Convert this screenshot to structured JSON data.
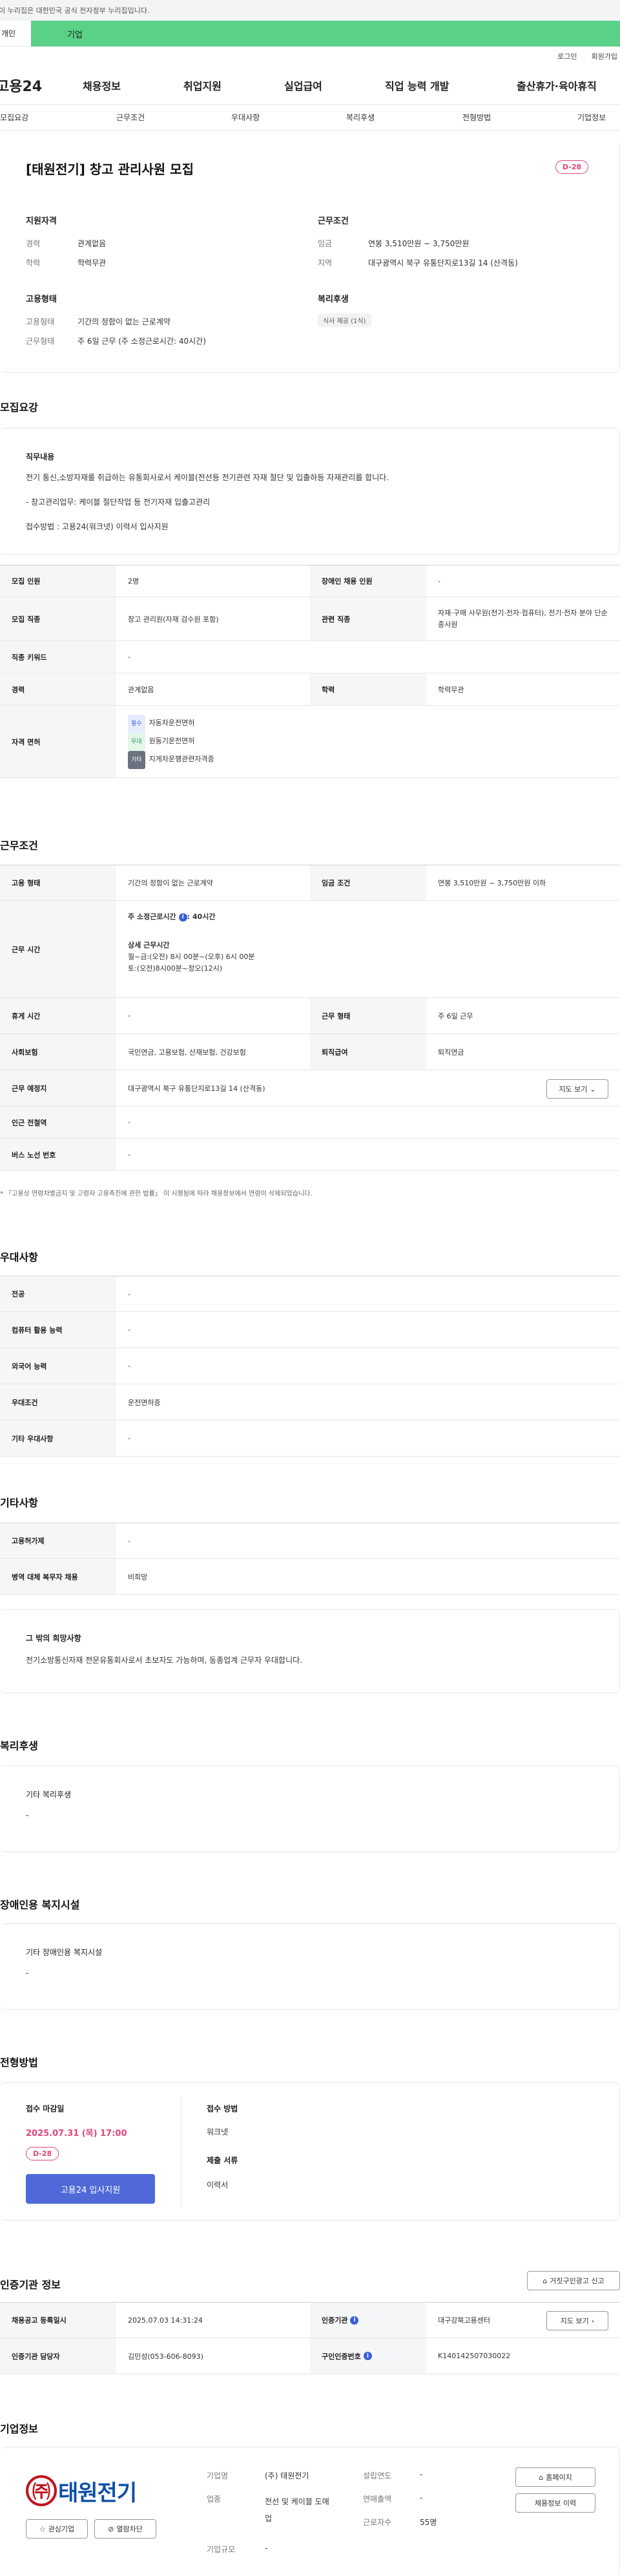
{
  "gov_notice": "이 누리집은 대한민국 공식 전자정부 누리집입니다.",
  "cat_tabs": {
    "left": "개인",
    "right": "기업"
  },
  "util": {
    "login": "로그인",
    "signup": "회원가입"
  },
  "gnb": {
    "logo": "고용24",
    "menu": [
      "채용정보",
      "취업지원",
      "실업급여",
      "직업 능력 개발",
      "출산휴가·육아휴직"
    ]
  },
  "subtabs": [
    "모집요강",
    "근무조건",
    "우대사항",
    "복리후생",
    "전형방법",
    "기업정보"
  ],
  "summary": {
    "title": "[태원전기] 창고 관리사원 모집",
    "dday": "D-28",
    "qual_title": "지원자격",
    "career_k": "경력",
    "career_v": "관계없음",
    "edu_k": "학력",
    "edu_v": "학력무관",
    "cond_title": "근무조건",
    "wage_k": "임금",
    "wage_v": "연봉 3,510만원 ~ 3,750만원",
    "region_k": "지역",
    "region_v": "대구광역시 북구 유통단지로13길 14 (산격동)",
    "emp_title": "고용형태",
    "emptype_k": "고용형태",
    "emptype_v": "기간의 정함이 없는 근로계약",
    "worktype_k": "근무형태",
    "worktype_v": "주 6일 근무 (주 소정근로시간: 40시간)",
    "welfare_title": "복리후생",
    "welfare_chip": "식사 제공 (1식)"
  },
  "recruit": {
    "heading": "모집요강",
    "duty_title": "직무내용",
    "duty_text": "전기 통신,소방자재를 취급하는 유통회사로서 케이블(전선등 전기관련 자재 절단 및 입출하등 자재관리를 합니다.",
    "duty_text2": "- 창고관리업무: 케이블 절단작업 등 전기자재 입출고관리",
    "duty_text3": "접수방법 : 고용24(워크넷) 이력서 입사지원",
    "rows": {
      "headcount_k": "모집 인원",
      "headcount_v": "2명",
      "disabled_k": "장애인 채용 인원",
      "disabled_v": "-",
      "job_k": "모집 직종",
      "job_v": "창고 관리원(자재 검수원 포함)",
      "related_k": "관련 직종",
      "related_v": "자재·구매 사무원(전기·전자·컴퓨터), 전기·전자 분야 단순 종사원",
      "keyword_k": "직종 키워드",
      "keyword_v": "-",
      "career_k": "경력",
      "career_v": "관계없음",
      "edu_k": "학력",
      "edu_v": "학력무관",
      "license_k": "자격 면허",
      "licenses": [
        {
          "badge": "필수",
          "name": "자동차운전면허"
        },
        {
          "badge": "우대",
          "name": "원동기운전면허"
        },
        {
          "badge": "기타",
          "name": "지게차운행관련자격증"
        }
      ]
    }
  },
  "work": {
    "heading": "근무조건",
    "emptype_k": "고용 형태",
    "emptype_v": "기간의 정함이 없는 근로계약",
    "wage_k": "임금 조건",
    "wage_v": "연봉 3,510만원 ~ 3,750만원 이하",
    "hours_k": "근무 시간",
    "hours_1": "주 소정근로시간",
    "hours_1v": ": 40시간",
    "hours_2": "상세 근무시간",
    "hours_3": "월~금:(오전) 8시 00분~(오후) 6시 00분",
    "hours_4": "토:(오전)8시00분~정오(12시)",
    "holiday_k": "휴게 시간",
    "holiday_v": "-",
    "worktype_k": "근무 형태",
    "worktype_v": "주 6일 근무",
    "insurance_k": "사회보험",
    "insurance_v": "국민연금, 고용보험, 산재보험, 건강보험",
    "retire_k": "퇴직급여",
    "retire_v": "퇴직연금",
    "place_k": "근무 예정지",
    "place_v": "대구광역시 북구 유통단지로13길 14 (산격동)",
    "map_btn": "지도 보기",
    "subway_k": "인근 전철역",
    "subway_v": "-",
    "bus_k": "버스 노선 번호",
    "bus_v": "-",
    "note": "* 「고용상 연령차별금지 및 고령자 고용촉진에 관한 법률」 이 시행됨에 따라 채용정보에서 연령이 삭제되었습니다."
  },
  "prefer": {
    "heading": "우대사항",
    "major_k": "전공",
    "major_v": "-",
    "computer_k": "컴퓨터 활용 능력",
    "computer_v": "-",
    "lang_k": "외국어 능력",
    "lang_v": "-",
    "cond_k": "우대조건",
    "cond_v": "운전면허증",
    "etc_k": "기타 우대사항",
    "etc_v": "-"
  },
  "other": {
    "heading": "기타사항",
    "type_k": "고용허가제",
    "type_v": "-",
    "military_k": "병역 대체 복무자 채용",
    "military_v": "비희망",
    "wish_title": "그 밖의 희망사항",
    "wish_text": "전기소방통신자재 전문유통회사로서 초보자도 가능하며, 동종업계 근무자 우대합니다."
  },
  "welfare": {
    "heading": "복리후생",
    "etc_title": "기타 복리후생",
    "etc_v": "-"
  },
  "facility": {
    "heading": "장애인용 복지시설",
    "title": "기타 장애인용 복지시설",
    "v": "-"
  },
  "process": {
    "heading": "전형방법",
    "deadline_title": "접수 마감일",
    "deadline": "2025.07.31 (목) 17:00",
    "dday": "D-28",
    "apply_btn": "고용24 입사지원",
    "method_title": "접수 방법",
    "method_v": "워크넷",
    "docs_title": "제출 서류",
    "docs_v": "이력서"
  },
  "agency": {
    "heading": "인증기관 정보",
    "report_btn": "거짓구인광고 신고",
    "reg_k": "채용공고 등록일시",
    "reg_v": "2025.07.03 14:31:24",
    "org_k": "인증기관",
    "org_v": "대구강북고용센터",
    "map_btn": "지도 보기",
    "mgr_k": "인증기관 담당자",
    "mgr_v": "김민성(053-606-8093)",
    "no_k": "구인인증번호",
    "no_v": "K140142507030022"
  },
  "company": {
    "heading": "기업정보",
    "logo_mark": "㈜",
    "logo_text": "태원전기",
    "fav_btn": "관심기업",
    "block_btn": "열람차단",
    "name_k": "기업명",
    "name_v": "(주) 태원전기",
    "ind_k": "업종",
    "ind_v": "전선 및 케이블 도매업",
    "size_k": "기업규모",
    "size_v": "-",
    "year_k": "설립연도",
    "year_v": "-",
    "sales_k": "연매출액",
    "sales_v": "-",
    "emp_k": "근로자수",
    "emp_v": "55명",
    "home_btn": "홈페이지",
    "hist_btn": "채용정보 이력"
  },
  "colors": {
    "accent": "#4f6ad8",
    "dday": "#e0457b",
    "green": "#5bd087",
    "logo_red": "#c1121f",
    "logo_blue": "#0f4fa8"
  }
}
